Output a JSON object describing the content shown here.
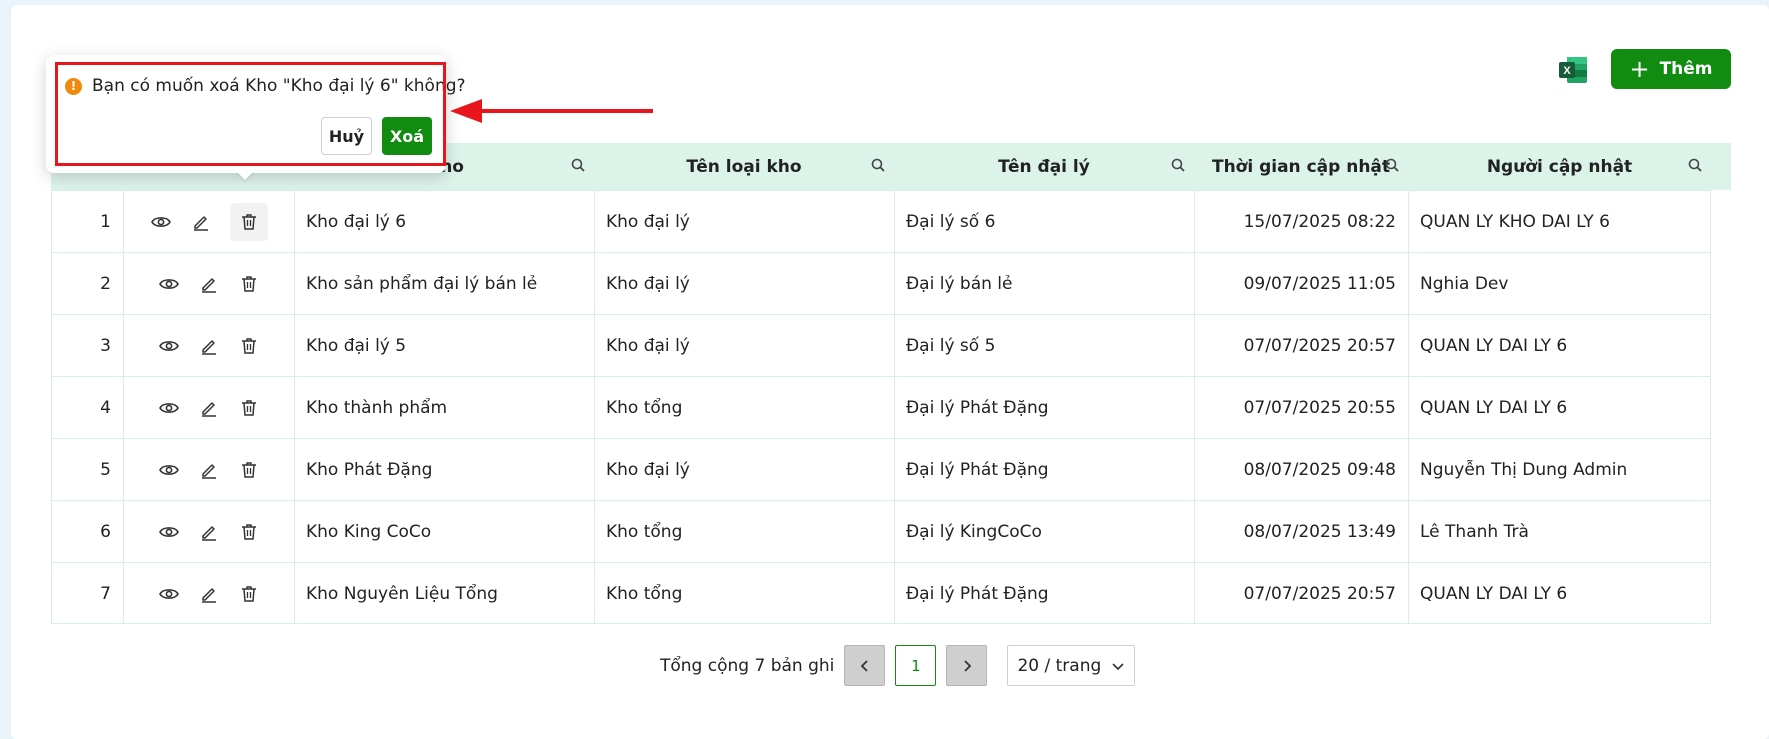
{
  "header": {
    "add_label": "Thêm",
    "excel_icon": "excel-icon"
  },
  "table": {
    "columns": [
      {
        "label": ""
      },
      {
        "label": ""
      },
      {
        "label": "ho"
      },
      {
        "label": "Tên loại kho"
      },
      {
        "label": "Tên đại lý"
      },
      {
        "label": "Thời gian cập nhật"
      },
      {
        "label": "Người cập nhật"
      }
    ],
    "rows": [
      {
        "stt": "1",
        "ten_kho": "Kho đại lý 6",
        "loai_kho": "Kho đại lý",
        "dai_ly": "Đại lý số 6",
        "thoi_gian": "15/07/2025 08:22",
        "nguoi": "QUAN LY KHO DAI LY 6"
      },
      {
        "stt": "2",
        "ten_kho": "Kho sản phẩm đại lý bán lẻ",
        "loai_kho": "Kho đại lý",
        "dai_ly": "Đại lý bán lẻ",
        "thoi_gian": "09/07/2025 11:05",
        "nguoi": "Nghia Dev"
      },
      {
        "stt": "3",
        "ten_kho": "Kho đại lý 5",
        "loai_kho": "Kho đại lý",
        "dai_ly": "Đại lý số 5",
        "thoi_gian": "07/07/2025 20:57",
        "nguoi": "QUAN LY DAI LY 6"
      },
      {
        "stt": "4",
        "ten_kho": "Kho thành phẩm",
        "loai_kho": "Kho tổng",
        "dai_ly": "Đại lý Phát Đặng",
        "thoi_gian": "07/07/2025 20:55",
        "nguoi": "QUAN LY DAI LY 6"
      },
      {
        "stt": "5",
        "ten_kho": "Kho Phát Đặng",
        "loai_kho": "Kho đại lý",
        "dai_ly": "Đại lý Phát Đặng",
        "thoi_gian": "08/07/2025 09:48",
        "nguoi": "Nguyễn Thị Dung Admin"
      },
      {
        "stt": "6",
        "ten_kho": "Kho King CoCo",
        "loai_kho": "Kho tổng",
        "dai_ly": "Đại lý KingCoCo",
        "thoi_gian": "08/07/2025 13:49",
        "nguoi": "Lê Thanh Trà"
      },
      {
        "stt": "7",
        "ten_kho": "Kho Nguyên Liệu Tổng",
        "loai_kho": "Kho tổng",
        "dai_ly": "Đại lý Phát Đặng",
        "thoi_gian": "07/07/2025 20:57",
        "nguoi": "QUAN LY DAI LY 6"
      }
    ]
  },
  "popconfirm": {
    "message": "Bạn có muốn xoá Kho \"Kho đại lý 6\" không?",
    "cancel_label": "Huỷ",
    "ok_label": "Xoá",
    "warning_mark": "!"
  },
  "pagination": {
    "total_text": "Tổng cộng 7 bản ghi",
    "current_page": "1",
    "page_size": "20 / trang"
  },
  "colors": {
    "primary_green": "#118c11",
    "header_bg": "#dcf3ea",
    "warning": "#f08a0c",
    "annotation_red": "#e8161c"
  }
}
